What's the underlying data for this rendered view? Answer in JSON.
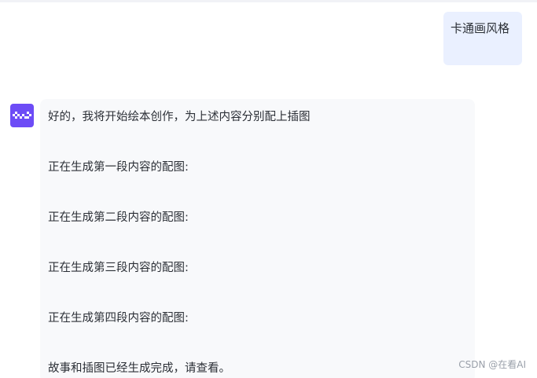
{
  "user_message": "卡通画风格",
  "assistant": {
    "avatar_icon": "assistant-logo-icon",
    "accent": "#6d4cf6",
    "lines": [
      "好的，我将开始绘本创作，为上述内容分别配上插图",
      "正在生成第一段内容的配图:",
      "正在生成第二段内容的配图:",
      "正在生成第三段内容的配图:",
      "正在生成第四段内容的配图:",
      "故事和插图已经生成完成，请查看。"
    ]
  },
  "watermark": "CSDN @在看AI"
}
